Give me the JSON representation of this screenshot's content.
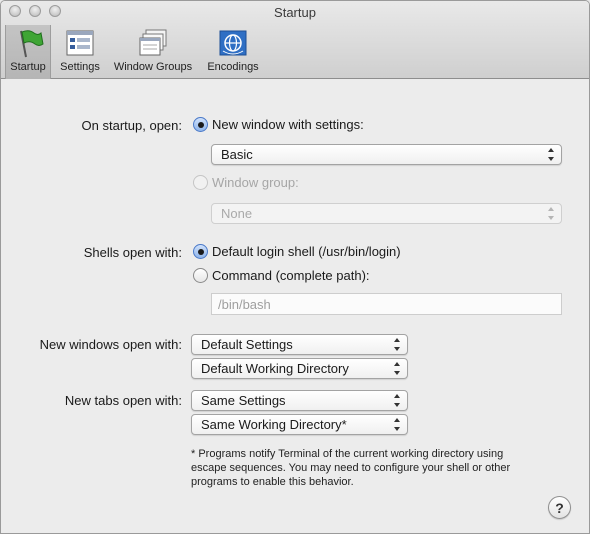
{
  "window": {
    "title": "Startup"
  },
  "toolbar": {
    "items": [
      {
        "label": "Startup",
        "icon": "startup-flag-icon",
        "selected": true
      },
      {
        "label": "Settings",
        "icon": "settings-icon",
        "selected": false
      },
      {
        "label": "Window Groups",
        "icon": "window-groups-icon",
        "selected": false
      },
      {
        "label": "Encodings",
        "icon": "encodings-globe-icon",
        "selected": false
      }
    ]
  },
  "startup": {
    "label": "On startup, open:",
    "new_window_option": "New window with settings:",
    "new_window_selected": true,
    "settings_popup": "Basic",
    "window_group_option": "Window group:",
    "window_group_popup": "None"
  },
  "shells": {
    "label": "Shells open with:",
    "default_option": "Default login shell (/usr/bin/login)",
    "default_selected": true,
    "command_option": "Command (complete path):",
    "command_placeholder": "/bin/bash"
  },
  "new_windows": {
    "label": "New windows open with:",
    "settings_popup": "Default Settings",
    "directory_popup": "Default Working Directory"
  },
  "new_tabs": {
    "label": "New tabs open with:",
    "settings_popup": "Same Settings",
    "directory_popup": "Same Working Directory*"
  },
  "footnote": {
    "line1": "* Programs notify Terminal of the current working directory using",
    "line2": "escape sequences. You may need to configure your shell or other",
    "line3": "programs to enable this behavior."
  },
  "help": {
    "label": "?"
  },
  "colors": {
    "accent": "#4a79c8",
    "toolbar_selected": "#b9b9b9"
  }
}
